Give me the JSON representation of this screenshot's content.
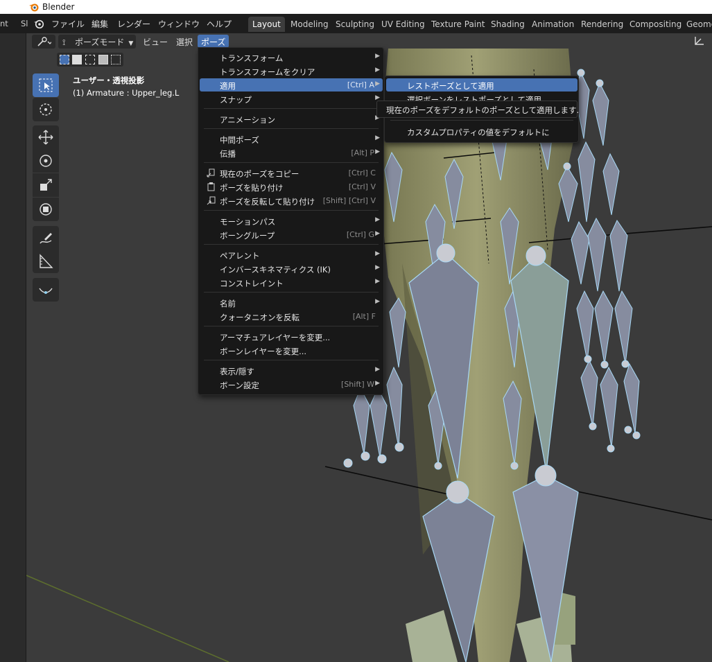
{
  "window": {
    "title": "Blender"
  },
  "topbar": {
    "clip_left_1": "nt",
    "clip_left_2": "Sl",
    "menus": [
      "ファイル",
      "編集",
      "レンダー",
      "ウィンドウ",
      "ヘルプ"
    ],
    "workspaces": [
      "Layout",
      "Modeling",
      "Sculpting",
      "UV Editing",
      "Texture Paint",
      "Shading",
      "Animation",
      "Rendering",
      "Compositing",
      "Geome"
    ],
    "active_workspace": "Layout"
  },
  "viewport_header": {
    "mode_label": "ポーズモード",
    "menus": [
      "ビュー",
      "選択",
      "ポーズ"
    ],
    "active_menu": "ポーズ"
  },
  "viewport_info": {
    "view_name": "ユーザー・透視投影",
    "object_line": "(1) Armature : Upper_leg.L"
  },
  "pose_menu": {
    "items": [
      {
        "label": "トランスフォーム",
        "shortcut": "",
        "submenu": true
      },
      {
        "label": "トランスフォームをクリア",
        "shortcut": "",
        "submenu": true
      },
      {
        "label": "適用",
        "shortcut": "[Ctrl] A",
        "submenu": true,
        "highlighted": true
      },
      {
        "label": "スナップ",
        "shortcut": "",
        "submenu": true
      },
      {
        "label": "アニメーション",
        "shortcut": "",
        "submenu": true
      },
      {
        "label": "中間ポーズ",
        "shortcut": "",
        "submenu": true
      },
      {
        "label": "伝播",
        "shortcut": "[Alt] P",
        "submenu": true
      },
      {
        "label": "現在のポーズをコピー",
        "shortcut": "[Ctrl] C",
        "icon": "copy-icon"
      },
      {
        "label": "ポーズを貼り付け",
        "shortcut": "[Ctrl] V",
        "icon": "paste-icon"
      },
      {
        "label": "ポーズを反転して貼り付け",
        "shortcut": "[Shift] [Ctrl] V",
        "icon": "paste-flipped-icon"
      },
      {
        "label": "モーションパス",
        "shortcut": "",
        "submenu": true
      },
      {
        "label": "ボーングループ",
        "shortcut": "[Ctrl] G",
        "submenu": true
      },
      {
        "label": "ペアレント",
        "shortcut": "",
        "submenu": true
      },
      {
        "label": "インバースキネマティクス (IK)",
        "shortcut": "",
        "submenu": true
      },
      {
        "label": "コンストレイント",
        "shortcut": "",
        "submenu": true
      },
      {
        "label": "名前",
        "shortcut": "",
        "submenu": true
      },
      {
        "label": "クォータニオンを反転",
        "shortcut": "[Alt] F"
      },
      {
        "label": "アーマチュアレイヤーを変更...",
        "shortcut": ""
      },
      {
        "label": "ボーンレイヤーを変更...",
        "shortcut": ""
      },
      {
        "label": "表示/隠す",
        "shortcut": "",
        "submenu": true
      },
      {
        "label": "ボーン設定",
        "shortcut": "[Shift] W",
        "submenu": true
      }
    ]
  },
  "apply_submenu": {
    "items": [
      {
        "label": "レストポーズとして適用",
        "highlighted": true
      },
      {
        "label": "選択ボーンをレストポーズとして適用"
      },
      {
        "label": "カスタムプロパティの値をデフォルトに"
      }
    ]
  },
  "tooltip": {
    "text": "現在のポーズをデフォルトのポーズとして適用します."
  },
  "colors": {
    "accent": "#4772b3",
    "menu_bg": "#181818",
    "viewport_bg": "#3b3b3b",
    "bone": "#8a90a5",
    "bone_outline": "#9fd6ff"
  }
}
